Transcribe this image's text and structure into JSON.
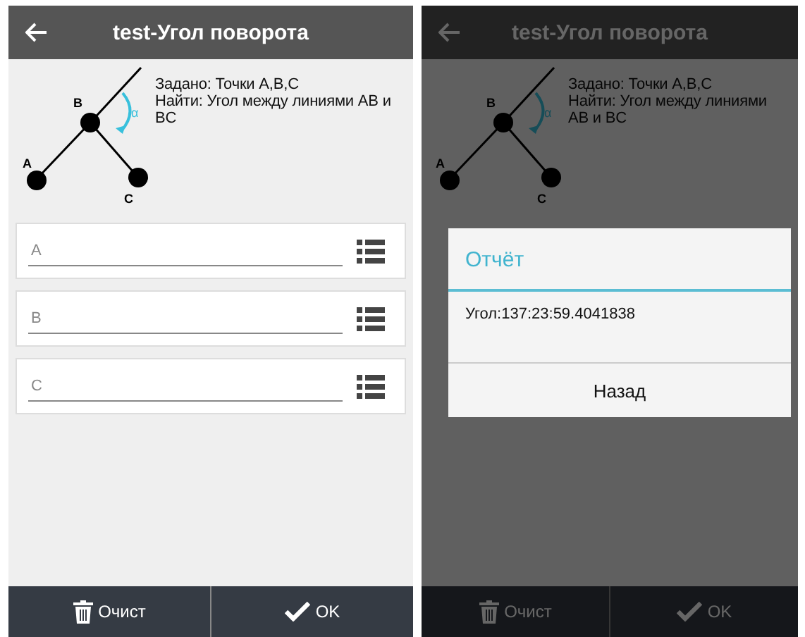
{
  "screens": [
    {
      "title": "test-Угол поворота",
      "dimmed": false,
      "diagram": {
        "point_labels": [
          "A",
          "B",
          "C"
        ],
        "angle_label": "α"
      },
      "task": [
        "Задано: Точки A,B,C",
        "Найти: Угол между линиями AB и BC"
      ],
      "fields": [
        {
          "placeholder": "A"
        },
        {
          "placeholder": "B"
        },
        {
          "placeholder": "C"
        }
      ],
      "buttons": [
        {
          "kind": "trash",
          "label": "Очист"
        },
        {
          "kind": "check",
          "label": "OK"
        }
      ]
    },
    {
      "title": "test-Угол поворота",
      "dimmed": true,
      "diagram": {
        "point_labels": [
          "A",
          "B",
          "C"
        ],
        "angle_label": "α"
      },
      "task": [
        "Задано: Точки A,B,C",
        "Найти: Угол между линиями AB и BC"
      ],
      "dialog": {
        "title": "Отчёт",
        "message": "Угол:137:23:59.4041838",
        "button": "Назад"
      },
      "buttons": [
        {
          "kind": "trash",
          "label": "Очист"
        },
        {
          "kind": "check",
          "label": "OK"
        }
      ]
    }
  ]
}
